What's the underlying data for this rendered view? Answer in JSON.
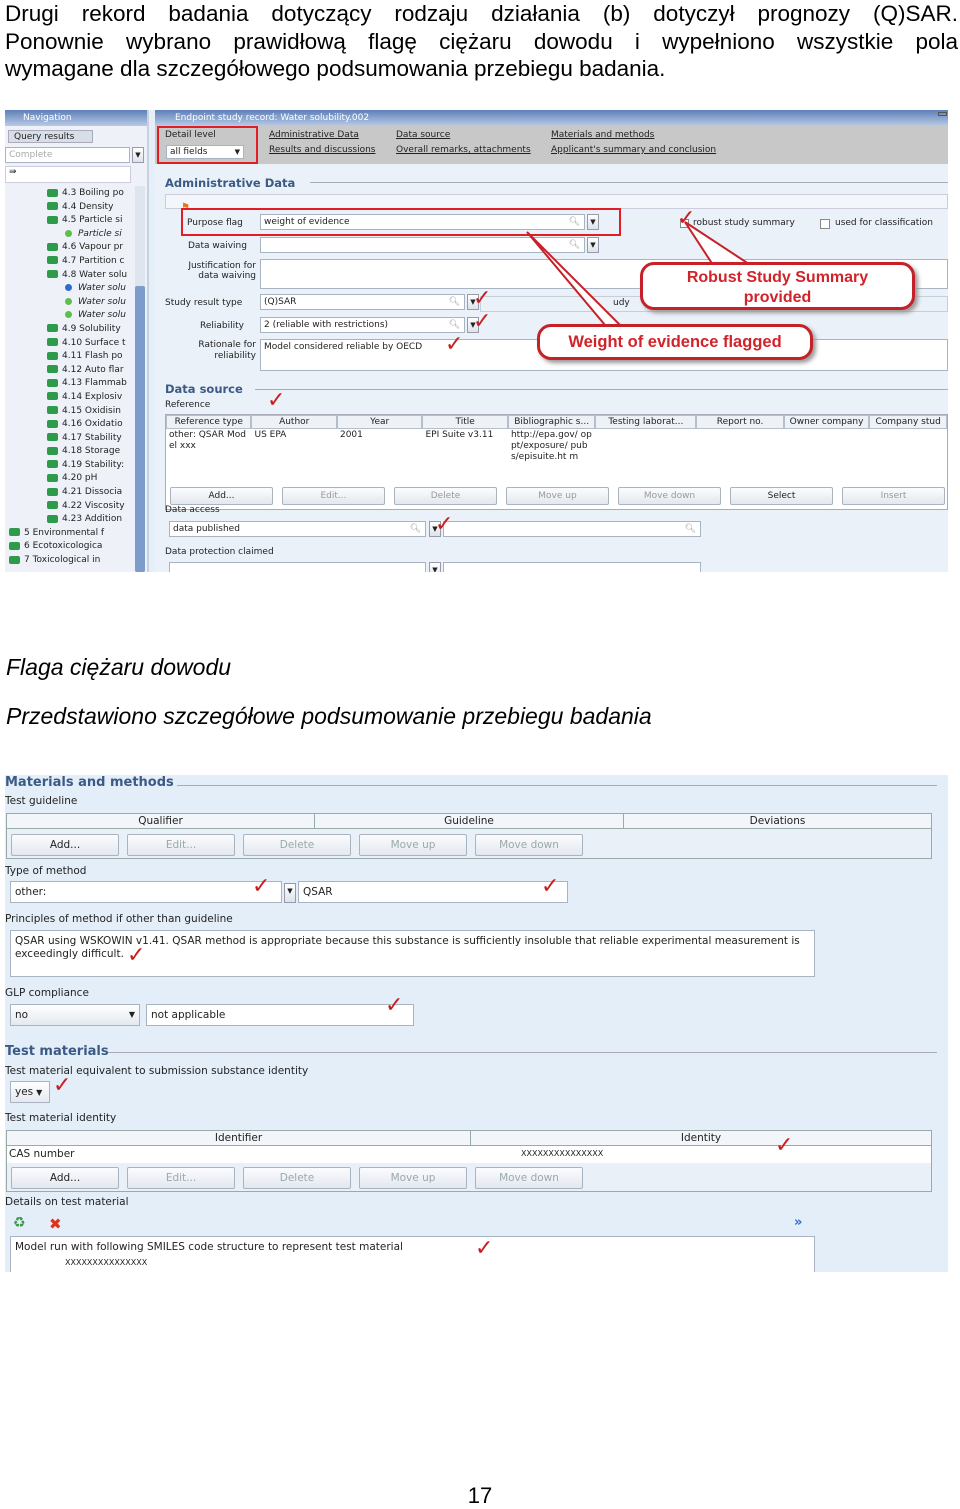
{
  "intro_paragraph_lines": [
    "Drugi rekord badania dotyczący rodzaju działania (b) dotyczył prognozy (Q)SAR.",
    "Ponownie wybrano prawidłową flagę ciężaru dowodu i wypełniono wszystkie pola",
    "wymagane dla szczegółowego podsumowania przebiegu badania."
  ],
  "screenshot1": {
    "navigation": {
      "title": "Navigation",
      "tab": "Query results",
      "search_placeholder": "Complete",
      "tree": [
        {
          "label": "4.3 Boiling po",
          "type": "folder"
        },
        {
          "label": "4.4 Density",
          "type": "folder"
        },
        {
          "label": "4.5 Particle si",
          "type": "folder"
        },
        {
          "label": "Particle si",
          "type": "record"
        },
        {
          "label": "4.6 Vapour pr",
          "type": "folder"
        },
        {
          "label": "4.7 Partition c",
          "type": "folder"
        },
        {
          "label": "4.8 Water solu",
          "type": "folder"
        },
        {
          "label": "Water solu",
          "type": "record-active"
        },
        {
          "label": "Water solu",
          "type": "record"
        },
        {
          "label": "Water solu",
          "type": "record"
        },
        {
          "label": "4.9 Solubility",
          "type": "folder"
        },
        {
          "label": "4.10 Surface t",
          "type": "folder"
        },
        {
          "label": "4.11 Flash po",
          "type": "folder"
        },
        {
          "label": "4.12 Auto flar",
          "type": "folder"
        },
        {
          "label": "4.13 Flammab",
          "type": "folder"
        },
        {
          "label": "4.14 Explosiv",
          "type": "folder"
        },
        {
          "label": "4.15 Oxidisin",
          "type": "folder"
        },
        {
          "label": "4.16 Oxidatio",
          "type": "folder"
        },
        {
          "label": "4.17 Stability",
          "type": "folder"
        },
        {
          "label": "4.18 Storage",
          "type": "folder"
        },
        {
          "label": "4.19 Stability:",
          "type": "folder"
        },
        {
          "label": "4.20 pH",
          "type": "folder"
        },
        {
          "label": "4.21 Dissocia",
          "type": "folder"
        },
        {
          "label": "4.22 Viscosity",
          "type": "folder"
        },
        {
          "label": "4.23 Addition",
          "type": "folder"
        },
        {
          "label": "5 Environmental f",
          "type": "root"
        },
        {
          "label": "6 Ecotoxicologica",
          "type": "root"
        },
        {
          "label": "7 Toxicological in",
          "type": "root"
        }
      ]
    },
    "record": {
      "title": "Endpoint study record: Water solubility.002",
      "detail_level_label": "Detail level",
      "detail_level_value": "all fields",
      "links": [
        "Administrative Data",
        "Data source",
        "Materials and methods",
        "Results and discussions",
        "Overall remarks, attachments",
        "Applicant's summary and conclusion"
      ],
      "admin_section": "Administrative Data",
      "purpose_flag_label": "Purpose flag",
      "purpose_flag_value": "weight of evidence",
      "robust_study_summary": "robust study summary",
      "robust_checked": true,
      "used_for_classification": "used for classification",
      "used_for_classification_checked": false,
      "data_waiving_label": "Data waiving",
      "justification_label_1": "Justification for",
      "justification_label_2": "data waiving",
      "study_result_type_label": "Study result type",
      "study_result_type_value": "(Q)SAR",
      "study_partial": "udy",
      "reliability_label": "Reliability",
      "reliability_value": "2 (reliable with restrictions)",
      "rationale_label_1": "Rationale for",
      "rationale_label_2": "reliability",
      "rationale_value": "Model considered reliable by OECD",
      "data_source_section": "Data source",
      "reference_label": "Reference",
      "ref_columns": [
        "Reference type",
        "Author",
        "Year",
        "Title",
        "Bibliographic s...",
        "Testing laborat...",
        "Report no.",
        "Owner company",
        "Company stud"
      ],
      "ref_row": [
        "other: QSAR Model xxx",
        "US EPA",
        "2001",
        "EPI Suite v3.11",
        "http://epa.gov/ oppt/exposure/ pubs/episuite.ht m",
        "",
        "",
        "",
        ""
      ],
      "ref_buttons": [
        "Add...",
        "Edit...",
        "Delete",
        "Move up",
        "Move down",
        "Select",
        "Insert"
      ],
      "data_access_label": "Data access",
      "data_access_value": "data published",
      "data_protection_label": "Data protection claimed"
    },
    "callouts": {
      "robust": "Robust Study Summary provided",
      "robust_line1": "Robust Study Summary",
      "robust_line2": "provided",
      "weight": "Weight of evidence flagged"
    },
    "accent_colors": {
      "annotation_red": "#e21d26",
      "section_blue": "#3b5a86"
    }
  },
  "caption1": "Flaga ciężaru dowodu",
  "caption2": "Przedstawiono szczegółowe podsumowanie przebiegu badania",
  "screenshot2": {
    "section": "Materials and methods",
    "test_guideline_label": "Test guideline",
    "guideline_columns": [
      "Qualifier",
      "Guideline",
      "Deviations"
    ],
    "buttons": [
      "Add...",
      "Edit...",
      "Delete",
      "Move up",
      "Move down"
    ],
    "type_of_method_label": "Type of method",
    "type_of_method_value": "other:",
    "type_of_method_other": "QSAR",
    "principles_label": "Principles of method if other than guideline",
    "principles_value_1": "QSAR using WSKOWIN v1.41.  QSAR method is appropriate because this substance is sufficiently insoluble that reliable experimental measurement is",
    "principles_value_2": "exceedingly difficult.",
    "glp_label": "GLP compliance",
    "glp_value": "no",
    "glp_remark": "not applicable",
    "test_materials_section": "Test materials",
    "equivalent_label": "Test material equivalent to submission substance identity",
    "equivalent_value": "yes",
    "identity_label": "Test material identity",
    "identity_columns": [
      "Identifier",
      "Identity"
    ],
    "identity_row": [
      "CAS number",
      "XXXXXXXXXXXXXXX"
    ],
    "details_label": "Details on test material",
    "details_value_1": "Model run with following SMILES code structure to represent test material",
    "details_value_2": "XXXXXXXXXXXXXXX"
  },
  "page_number": "17"
}
